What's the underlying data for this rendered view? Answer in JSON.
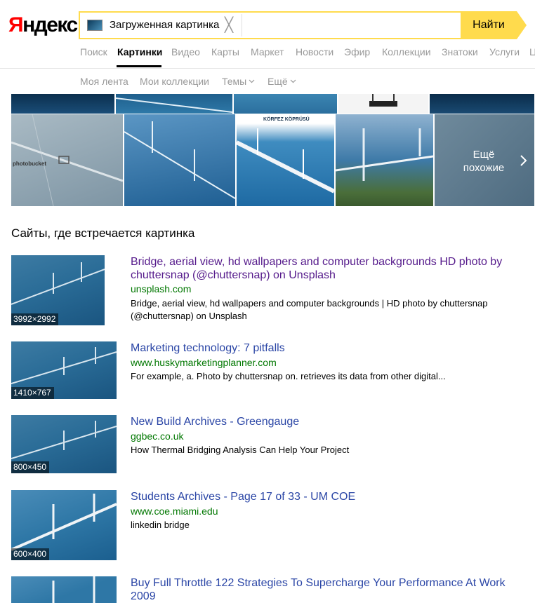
{
  "logo": {
    "first": "Я",
    "rest": "ндекс"
  },
  "search": {
    "chip_label": "Загруженная картинка",
    "close_glyph": "╳",
    "button_label": "Найти"
  },
  "services": [
    {
      "label": "Поиск",
      "active": false
    },
    {
      "label": "Картинки",
      "active": true
    },
    {
      "label": "Видео",
      "active": false
    },
    {
      "label": "Карты",
      "active": false
    },
    {
      "label": "Маркет",
      "active": false
    },
    {
      "label": "Новости",
      "active": false
    },
    {
      "label": "Эфир",
      "active": false
    },
    {
      "label": "Коллекции",
      "active": false
    },
    {
      "label": "Знатоки",
      "active": false
    },
    {
      "label": "Услуги",
      "active": false
    },
    {
      "label": "Ц",
      "active": false
    }
  ],
  "subnav": [
    {
      "label": "Моя лента",
      "dropdown": false
    },
    {
      "label": "Мои коллекции",
      "dropdown": false
    },
    {
      "label": "Темы",
      "dropdown": true
    },
    {
      "label": "Ещё",
      "dropdown": true
    }
  ],
  "similar": {
    "tile_annotations": {
      "watermark": "photobucket",
      "korfez": "KÖRFEZ KÖPRÜSÜ"
    },
    "more_label_line1": "Ещё",
    "more_label_line2": "похожие"
  },
  "sites": {
    "title": "Сайты, где встречается картинка",
    "results": [
      {
        "size": "3992×2992",
        "title": "Bridge, aerial view, hd wallpapers and computer backgrounds HD photo by chuttersnap (@chuttersnap) on Unsplash",
        "visited": true,
        "domain": "unsplash.com",
        "snippet": "Bridge, aerial view, hd wallpapers and computer backgrounds | HD photo by chuttersnap (@chuttersnap) on Unsplash"
      },
      {
        "size": "1410×767",
        "title": "Marketing technology: 7 pitfalls",
        "visited": false,
        "domain": "www.huskymarketingplanner.com",
        "snippet": "For example, a. Photo by chuttersnap on. retrieves its data from other digital..."
      },
      {
        "size": "800×450",
        "title": "New Build Archives - Greengauge",
        "visited": false,
        "domain": "ggbec.co.uk",
        "snippet": "How Thermal Bridging Analysis Can Help Your Project"
      },
      {
        "size": "600×400",
        "title": "Students Archives - Page 17 of 33 - UM COE",
        "visited": false,
        "domain": "www.coe.miami.edu",
        "snippet": "linkedin bridge"
      },
      {
        "size": "",
        "title": "Buy Full Throttle 122 Strategies To Supercharge Your Performance At Work 2009",
        "visited": false,
        "domain": "",
        "snippet": ""
      }
    ]
  },
  "colors": {
    "accent": "#ffdb4d",
    "link": "#2b46a6",
    "visited": "#551a8b",
    "domain": "#007700",
    "muted": "#999999"
  }
}
